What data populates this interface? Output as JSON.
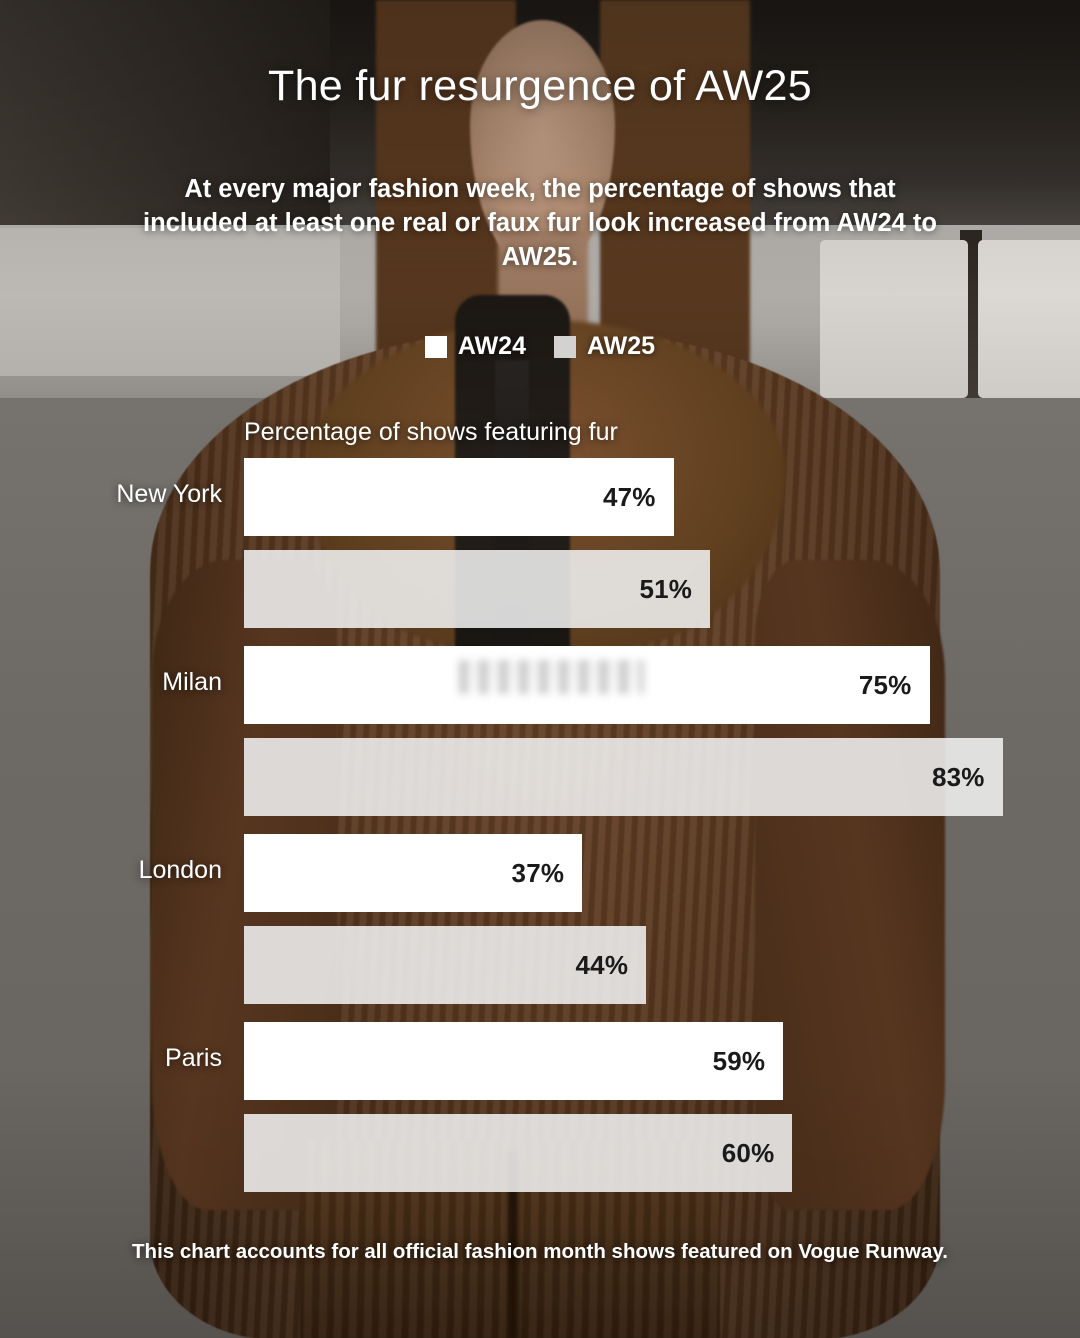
{
  "header": {
    "title": "The fur resurgence of AW25",
    "subtitle": "At every major fashion week, the percentage of shows that included at least one real or faux fur look increased from AW24 to AW25."
  },
  "legend": {
    "items": [
      {
        "label": "AW24",
        "color": "#ffffff"
      },
      {
        "label": "AW25",
        "color": "#d4d2d0"
      }
    ]
  },
  "footnote": "This chart accounts for all official fashion month shows featured on Vogue Runway.",
  "chart_data": {
    "type": "bar",
    "orientation": "horizontal",
    "title": "The fur resurgence of AW25",
    "axis_title": "Percentage of shows featuring fur",
    "xlabel": "Percentage of shows featuring fur",
    "ylabel": "",
    "xlim": [
      0,
      100
    ],
    "grid": false,
    "legend_position": "top-center",
    "categories": [
      "New York",
      "Milan",
      "London",
      "Paris"
    ],
    "series": [
      {
        "name": "AW24",
        "color": "#ffffff",
        "values": [
          47,
          75,
          37,
          59
        ]
      },
      {
        "name": "AW25",
        "color": "#d4d2d0",
        "values": [
          51,
          83,
          44,
          60
        ]
      }
    ],
    "value_labels": [
      [
        "47%",
        "51%"
      ],
      [
        "75%",
        "83%"
      ],
      [
        "37%",
        "44%"
      ],
      [
        "59%",
        "60%"
      ]
    ],
    "annotations": [
      "Blurred/redacted watermark overlay inside the Milan AW24 bar"
    ]
  },
  "groups": [
    {
      "category": "New York",
      "aw24": {
        "label": "47%",
        "pct": 47
      },
      "aw25": {
        "label": "51%",
        "pct": 51
      }
    },
    {
      "category": "Milan",
      "aw24": {
        "label": "75%",
        "pct": 75
      },
      "aw25": {
        "label": "83%",
        "pct": 83
      }
    },
    {
      "category": "London",
      "aw24": {
        "label": "37%",
        "pct": 37
      },
      "aw25": {
        "label": "44%",
        "pct": 44
      }
    },
    {
      "category": "Paris",
      "aw24": {
        "label": "59%",
        "pct": 59
      },
      "aw25": {
        "label": "60%",
        "pct": 60
      }
    }
  ]
}
